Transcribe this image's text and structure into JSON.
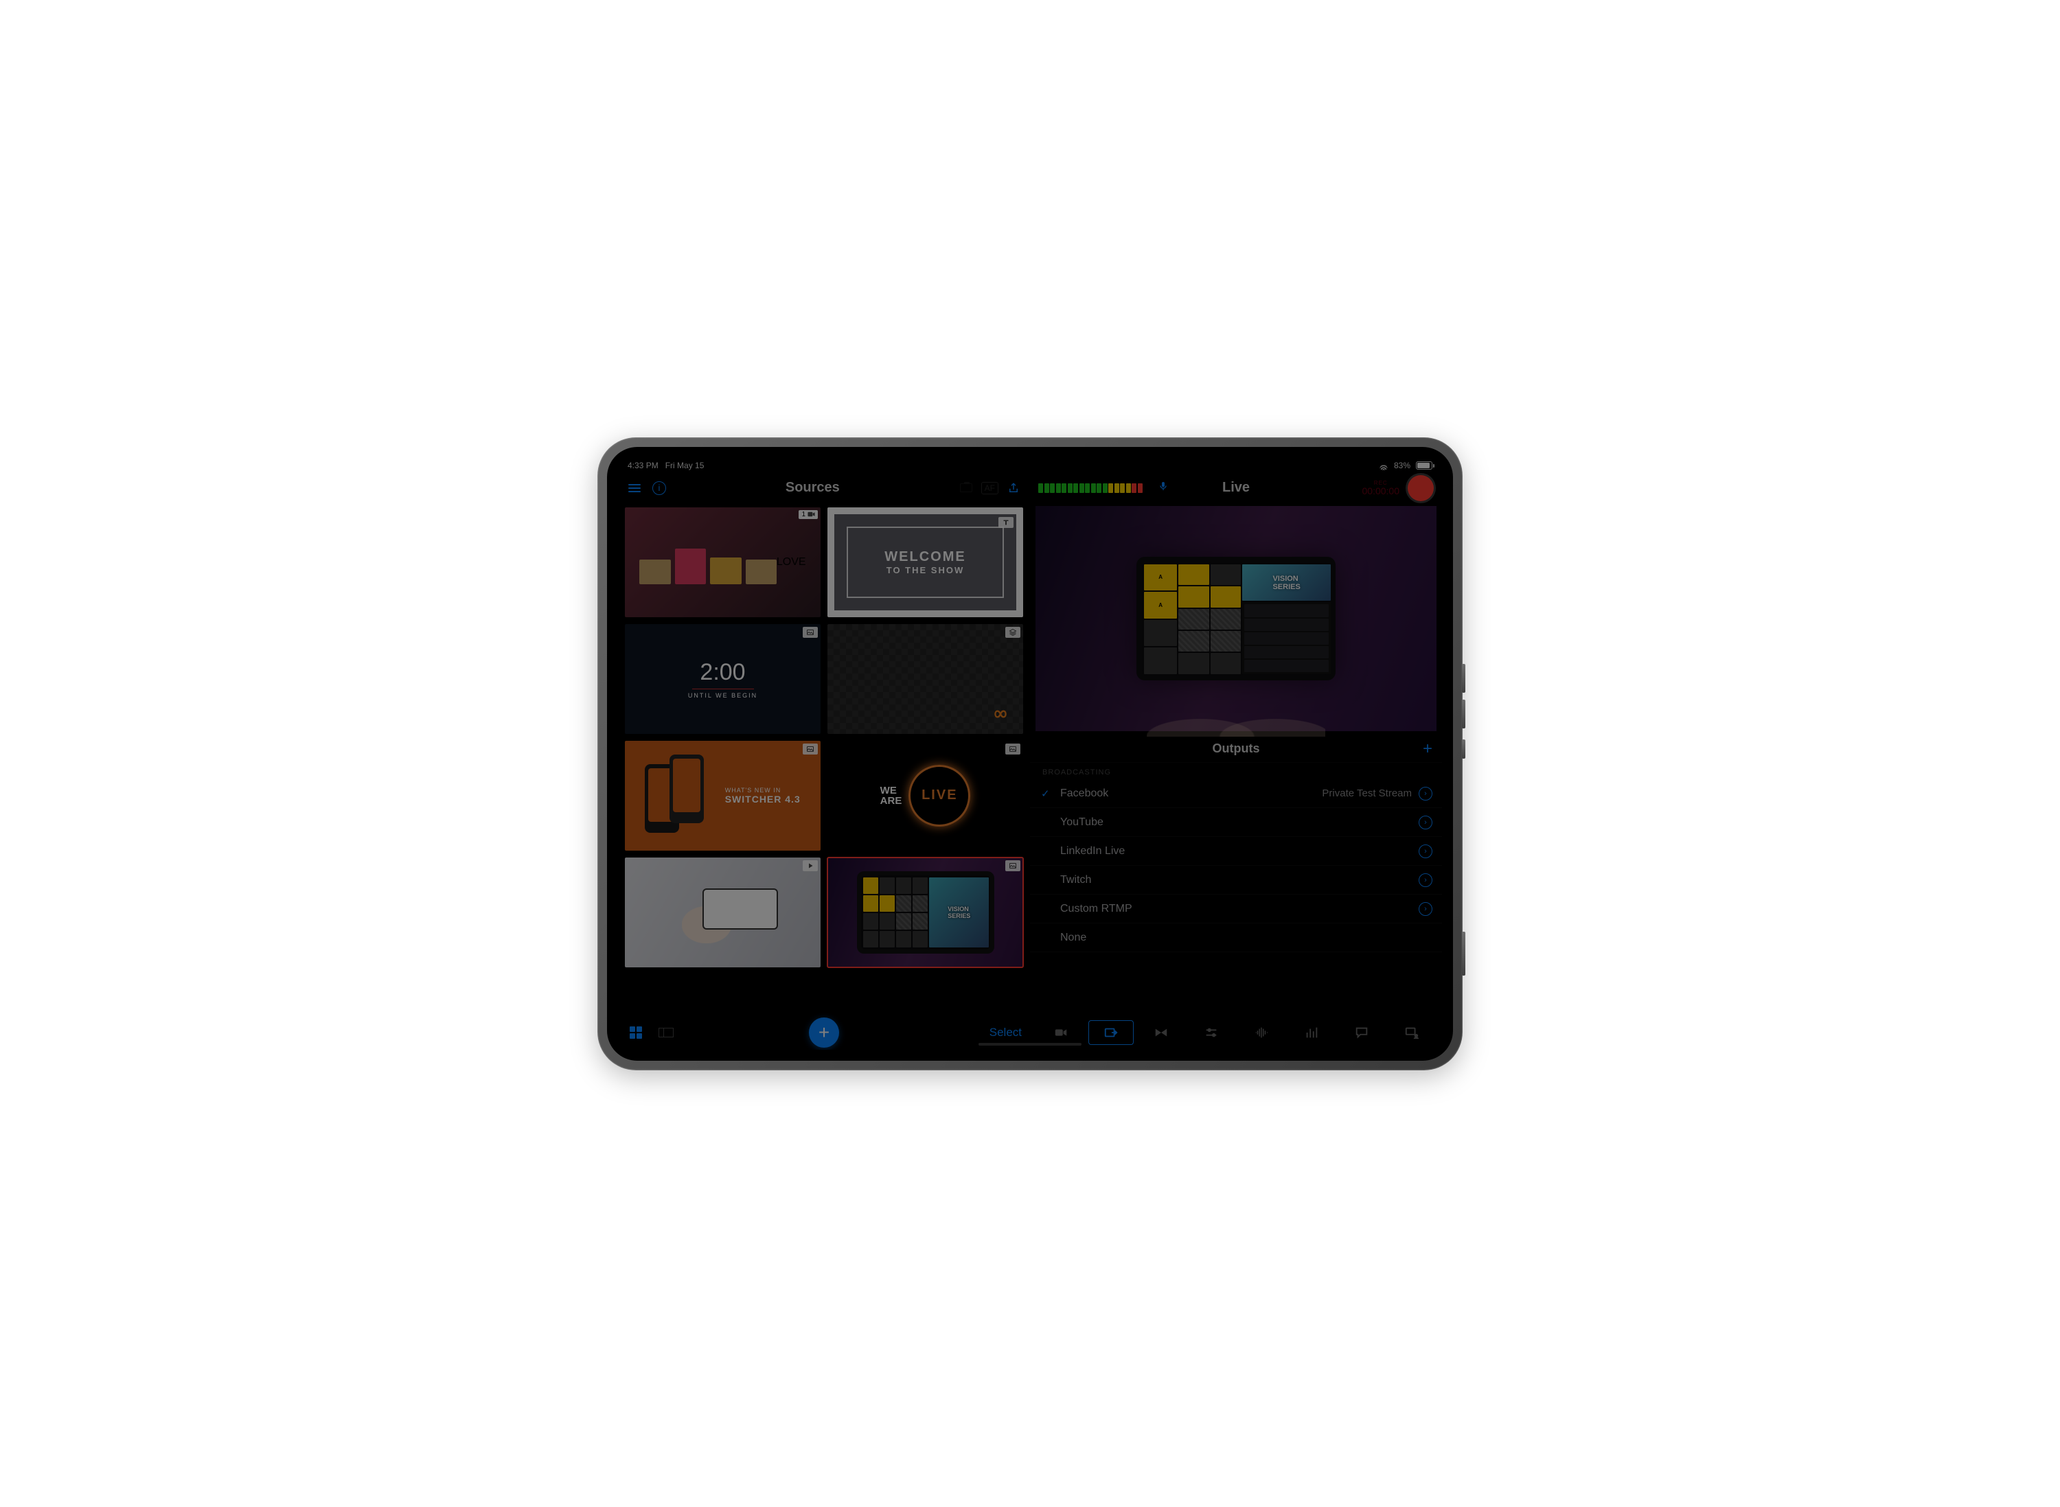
{
  "statusbar": {
    "time": "4:33 PM",
    "date": "Fri May 15",
    "battery_pct": "83%"
  },
  "left": {
    "title": "Sources",
    "af_label": "AF",
    "bottom": {
      "select_label": "Select"
    },
    "tile_badge": {
      "num": "1"
    },
    "tiles": {
      "welcome_l1": "WELCOME",
      "welcome_l2": "TO THE SHOW",
      "countdown_time": "2:00",
      "countdown_sub": "UNTIL WE BEGIN",
      "whats_new_l1": "WHAT'S NEW IN",
      "whats_new_l2": "SWITCHER 4.3",
      "we": "WE",
      "are": "ARE",
      "live": "LIVE",
      "love": "LOVE"
    }
  },
  "right": {
    "title": "Live",
    "timecode_lbl": "00:00:00",
    "timecode_sm": "REC",
    "preview_badge": "VISION\nSERIES",
    "outputs": {
      "title": "Outputs",
      "section": "BROADCASTING",
      "items": [
        {
          "name": "Facebook",
          "status": "Private Test Stream",
          "checked": true
        },
        {
          "name": "YouTube",
          "status": "",
          "checked": false
        },
        {
          "name": "LinkedIn Live",
          "status": "",
          "checked": false
        },
        {
          "name": "Twitch",
          "status": "",
          "checked": false
        },
        {
          "name": "Custom RTMP",
          "status": "",
          "checked": false
        },
        {
          "name": "None",
          "status": "",
          "checked": false
        }
      ]
    },
    "tabs": [
      "inputs",
      "outputs",
      "display",
      "sliders",
      "audio",
      "levels",
      "chat",
      "screen-share"
    ]
  },
  "colors": {
    "accent": "#0a84ff",
    "record": "#ff3b30"
  }
}
